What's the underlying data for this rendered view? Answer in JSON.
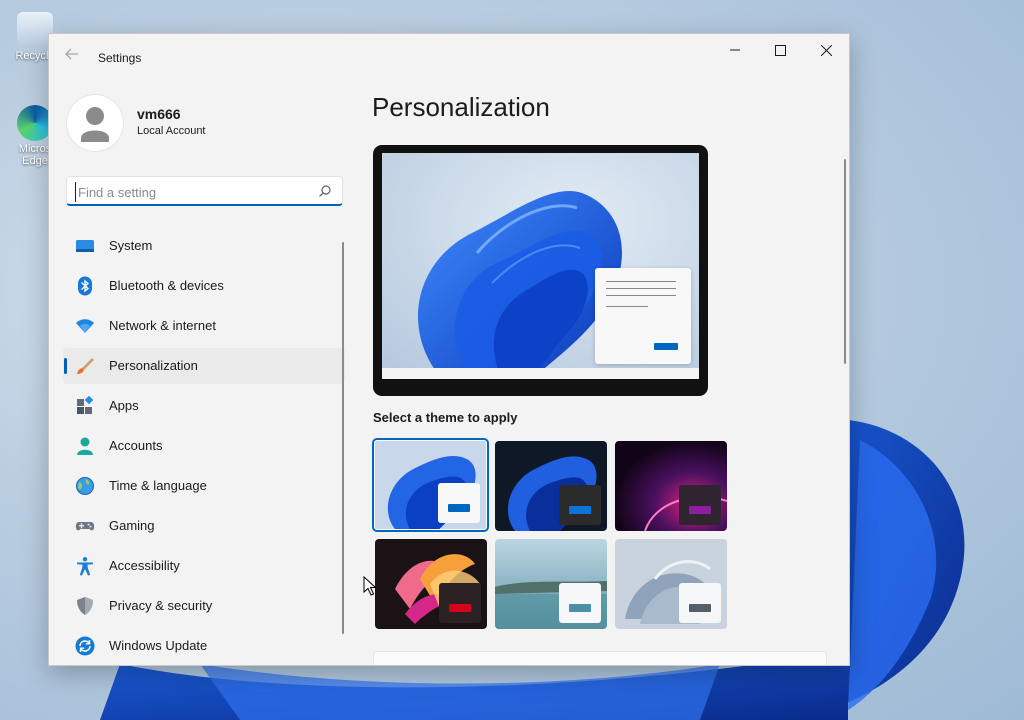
{
  "desktop": {
    "icons": [
      {
        "label": "Recycle",
        "icon": "recycle-bin-icon"
      },
      {
        "label": "Micros Edge",
        "icon": "edge-icon"
      }
    ]
  },
  "window": {
    "title": "Settings",
    "controls": {
      "minimize": "minimize-icon",
      "maximize": "maximize-icon",
      "close": "close-icon"
    }
  },
  "profile": {
    "name": "vm666",
    "account_type": "Local Account"
  },
  "search": {
    "placeholder": "Find a setting",
    "value": ""
  },
  "sidebar": {
    "items": [
      {
        "label": "System",
        "icon": "system-icon",
        "selected": false
      },
      {
        "label": "Bluetooth & devices",
        "icon": "bluetooth-icon",
        "selected": false
      },
      {
        "label": "Network & internet",
        "icon": "wifi-icon",
        "selected": false
      },
      {
        "label": "Personalization",
        "icon": "brush-icon",
        "selected": true
      },
      {
        "label": "Apps",
        "icon": "apps-icon",
        "selected": false
      },
      {
        "label": "Accounts",
        "icon": "person-icon",
        "selected": false
      },
      {
        "label": "Time & language",
        "icon": "globe-icon",
        "selected": false
      },
      {
        "label": "Gaming",
        "icon": "gamepad-icon",
        "selected": false
      },
      {
        "label": "Accessibility",
        "icon": "accessibility-icon",
        "selected": false
      },
      {
        "label": "Privacy & security",
        "icon": "shield-icon",
        "selected": false
      },
      {
        "label": "Windows Update",
        "icon": "update-icon",
        "selected": false
      }
    ]
  },
  "main": {
    "page_title": "Personalization",
    "theme_section_label": "Select a theme to apply",
    "themes": [
      {
        "name": "windows-light",
        "selected": true,
        "accent": "#0067c0"
      },
      {
        "name": "windows-dark",
        "selected": false,
        "accent": "#0067c0"
      },
      {
        "name": "glow",
        "selected": false,
        "accent": "#8b1fa0"
      },
      {
        "name": "captured-motion",
        "selected": false,
        "accent": "#d6001c"
      },
      {
        "name": "sunrise",
        "selected": false,
        "accent": "#4a8fa6"
      },
      {
        "name": "flow",
        "selected": false,
        "accent": "#555e6b"
      }
    ]
  },
  "colors": {
    "accent": "#005fb8",
    "window_bg": "#f3f3f3"
  }
}
